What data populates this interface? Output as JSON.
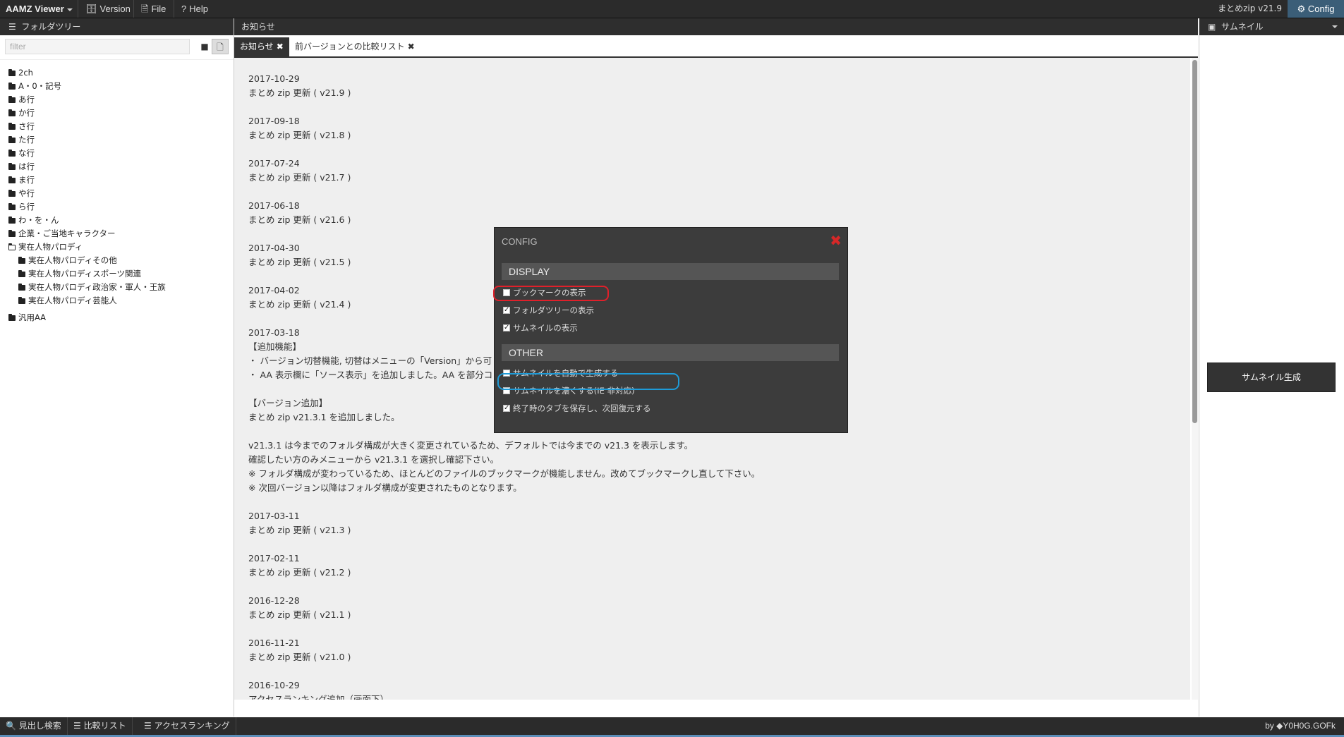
{
  "topbar": {
    "brand": "AAMZ Viewer",
    "menu": [
      {
        "icon": "database-icon",
        "label": "Version"
      },
      {
        "icon": "file-icon",
        "label": "File"
      },
      {
        "icon": "question-icon",
        "label": "Help"
      }
    ],
    "version_text": "まとめzip v21.9",
    "config_label": "Config"
  },
  "left_panel": {
    "title": "フォルダツリー",
    "filter_placeholder": "filter",
    "tree": [
      {
        "label": "2ch",
        "level": 0,
        "open": false
      },
      {
        "label": "A・0・記号",
        "level": 0,
        "open": false
      },
      {
        "label": "あ行",
        "level": 0,
        "open": false
      },
      {
        "label": "か行",
        "level": 0,
        "open": false
      },
      {
        "label": "さ行",
        "level": 0,
        "open": false
      },
      {
        "label": "た行",
        "level": 0,
        "open": false
      },
      {
        "label": "な行",
        "level": 0,
        "open": false
      },
      {
        "label": "は行",
        "level": 0,
        "open": false
      },
      {
        "label": "ま行",
        "level": 0,
        "open": false
      },
      {
        "label": "や行",
        "level": 0,
        "open": false
      },
      {
        "label": "ら行",
        "level": 0,
        "open": false
      },
      {
        "label": "わ・を・ん",
        "level": 0,
        "open": false
      },
      {
        "label": "企業・ご当地キャラクター",
        "level": 0,
        "open": false
      },
      {
        "label": "実在人物パロディ",
        "level": 0,
        "open": true
      },
      {
        "label": "実在人物パロディその他",
        "level": 1,
        "open": false
      },
      {
        "label": "実在人物パロディスポーツ関連",
        "level": 1,
        "open": false
      },
      {
        "label": "実在人物パロディ政治家・軍人・王族",
        "level": 1,
        "open": false
      },
      {
        "label": "実在人物パロディ芸能人",
        "level": 1,
        "open": false
      },
      {
        "label": "汎用AA",
        "level": 0,
        "open": false,
        "gap": true
      }
    ]
  },
  "center": {
    "title": "お知らせ",
    "tabs": [
      {
        "label": "お知らせ",
        "active": true
      },
      {
        "label": "前バージョンとの比較リスト",
        "active": false
      }
    ],
    "entries": [
      {
        "lines": [
          "2017-10-29",
          "まとめ zip 更新 ( v21.9 )"
        ]
      },
      {
        "lines": [
          "2017-09-18",
          "まとめ zip 更新 ( v21.8 )"
        ]
      },
      {
        "lines": [
          "2017-07-24",
          "まとめ zip 更新 ( v21.7 )"
        ]
      },
      {
        "lines": [
          "2017-06-18",
          "まとめ zip 更新 ( v21.6 )"
        ]
      },
      {
        "lines": [
          "2017-04-30",
          "まとめ zip 更新 ( v21.5 )"
        ]
      },
      {
        "lines": [
          "2017-04-02",
          "まとめ zip 更新 ( v21.4 )"
        ]
      },
      {
        "lines": [
          "2017-03-18",
          "【追加機能】",
          "・ バージョン切替機能, 切替はメニューの「Version」から可",
          "・ AA 表示欄に「ソース表示」を追加しました。AA を部分コ"
        ]
      },
      {
        "lines": [
          "【バージョン追加】",
          "まとめ zip v21.3.1 を追加しました。"
        ]
      },
      {
        "lines": [
          "v21.3.1 は今までのフォルダ構成が大きく変更されているため、デフォルトでは今までの v21.3 を表示します。",
          "確認したい方のみメニューから v21.3.1 を選択し確認下さい。",
          "※ フォルダ構成が変わっているため、ほとんどのファイルのブックマークが機能しません。改めてブックマークし直して下さい。",
          "※ 次回バージョン以降はフォルダ構成が変更されたものとなります。"
        ]
      },
      {
        "lines": [
          "2017-03-11",
          "まとめ zip 更新 ( v21.3 )"
        ]
      },
      {
        "lines": [
          "2017-02-11",
          "まとめ zip 更新 ( v21.2 )"
        ]
      },
      {
        "lines": [
          "2016-12-28",
          "まとめ zip 更新 ( v21.1 )"
        ]
      },
      {
        "lines": [
          "2016-11-21",
          "まとめ zip 更新 ( v21.0 )"
        ]
      },
      {
        "lines": [
          "2016-10-29",
          "アクセスランキング追加（画面下）"
        ]
      }
    ]
  },
  "right_panel": {
    "title": "サムネイル",
    "generate_label": "サムネイル生成"
  },
  "config_modal": {
    "title": "CONFIG",
    "close_glyph": "✖",
    "display_section": "DISPLAY",
    "display_options": [
      {
        "label": "ブックマークの表示",
        "checked": false
      },
      {
        "label": "フォルダツリーの表示",
        "checked": true
      },
      {
        "label": "サムネイルの表示",
        "checked": true
      }
    ],
    "other_section": "OTHER",
    "other_options": [
      {
        "label": "サムネイルを自動で生成する",
        "checked": false
      },
      {
        "label": "サムネイルを濃くする(IE 非対応)",
        "checked": false
      },
      {
        "label": "終了時のタブを保存し、次回復元する",
        "checked": true
      }
    ],
    "annotation_colors": {
      "red": "#e0202a",
      "blue": "#1e9bd8"
    }
  },
  "bottombar": {
    "items": [
      {
        "icon": "search-icon",
        "label": "見出し検索"
      },
      {
        "icon": "list-icon",
        "label": "比較リスト"
      },
      {
        "icon": "list-icon",
        "label": "アクセスランキング"
      }
    ],
    "credit": "by ◆Y0H0G.GOFk"
  }
}
